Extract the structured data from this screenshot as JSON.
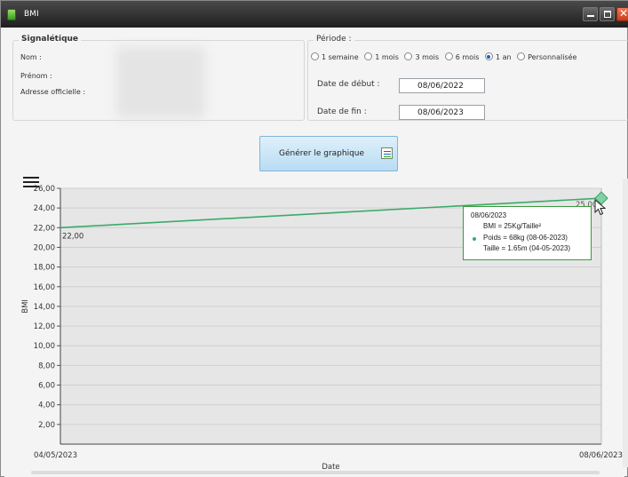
{
  "window": {
    "title": "BMI"
  },
  "signaletique": {
    "legend": "Signalétique",
    "nom_label": "Nom :",
    "prenom_label": "Prénom :",
    "adresse_label": "Adresse officielle :"
  },
  "periode": {
    "legend": "Période :",
    "options": [
      "1 semaine",
      "1 mois",
      "3 mois",
      "6 mois",
      "1 an",
      "Personnalisée"
    ],
    "selected": "1 an",
    "start_label": "Date de début :",
    "start_value": "08/06/2022",
    "end_label": "Date de fin :",
    "end_value": "08/06/2023"
  },
  "generate_button": {
    "label": "Générer le graphique",
    "icon": "chart-icon"
  },
  "chart_data": {
    "type": "line",
    "x": [
      "04/05/2023",
      "08/06/2023"
    ],
    "series": [
      {
        "values": [
          22.0,
          25.0
        ],
        "point_labels": [
          "22,00",
          "25,00"
        ]
      }
    ],
    "ylim": [
      0,
      26
    ],
    "yticks": [
      "2,00",
      "4,00",
      "6,00",
      "8,00",
      "10,00",
      "12,00",
      "14,00",
      "16,00",
      "18,00",
      "20,00",
      "22,00",
      "24,00",
      "26,00"
    ],
    "xlabel": "Date",
    "ylabel": "BMI",
    "grid": true,
    "line_color": "#3aaa6a",
    "tooltip": {
      "date": "08/06/2023",
      "bmi": "BMI = 25Kg/Taille²",
      "poids": "Poids = 68kg (08-06-2023)",
      "taille": "Taille = 1.65m (04-05-2023)"
    }
  }
}
